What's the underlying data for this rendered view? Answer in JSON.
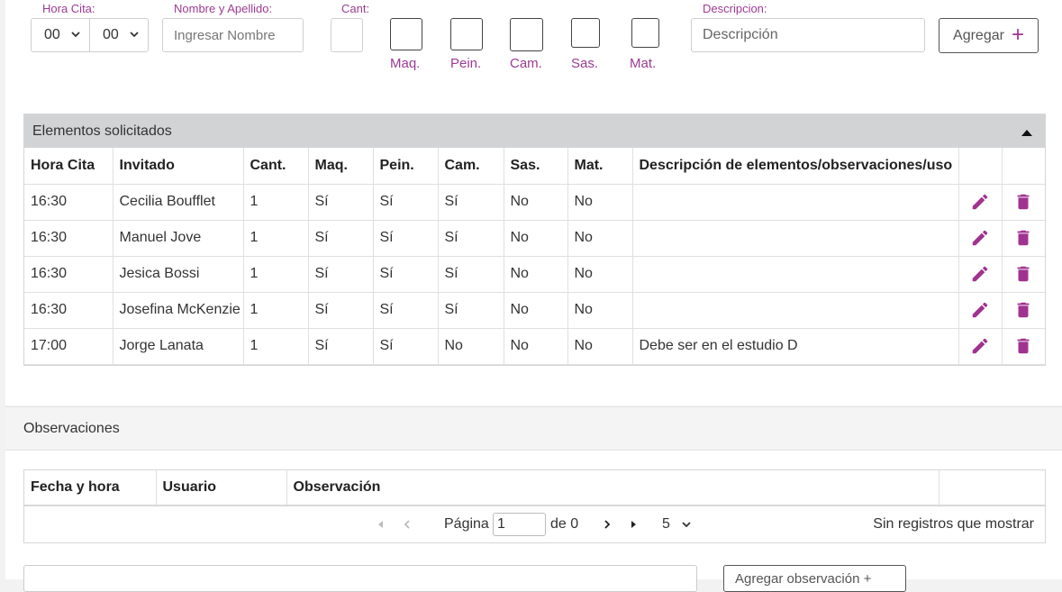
{
  "form": {
    "hora_label": "Hora Cita:",
    "hour_value": "00",
    "minute_value": "00",
    "nombre_label": "Nombre y Apellido:",
    "nombre_placeholder": "Ingresar Nombre",
    "cant_label": "Cant:",
    "checks": [
      "Maq.",
      "Pein.",
      "Cam.",
      "Sas.",
      "Mat."
    ],
    "desc_label": "Descripcion:",
    "desc_placeholder": "Descripción",
    "add_button": "Agregar",
    "add_icon": "+"
  },
  "elementos": {
    "title": "Elementos solicitados",
    "columns": [
      "Hora Cita",
      "Invitado",
      "Cant.",
      "Maq.",
      "Pein.",
      "Cam.",
      "Sas.",
      "Mat.",
      "Descripción de elementos/observaciones/uso",
      "",
      ""
    ],
    "rows": [
      [
        "16:30",
        "Cecilia Boufflet",
        "1",
        "Sí",
        "Sí",
        "Sí",
        "No",
        "No",
        ""
      ],
      [
        "16:30",
        "Manuel Jove",
        "1",
        "Sí",
        "Sí",
        "Sí",
        "No",
        "No",
        ""
      ],
      [
        "16:30",
        "Jesica Bossi",
        "1",
        "Sí",
        "Sí",
        "Sí",
        "No",
        "No",
        ""
      ],
      [
        "16:30",
        "Josefina McKenzie",
        "1",
        "Sí",
        "Sí",
        "Sí",
        "No",
        "No",
        ""
      ],
      [
        "17:00",
        "Jorge Lanata",
        "1",
        "Sí",
        "Sí",
        "No",
        "No",
        "No",
        "Debe ser en el estudio D"
      ]
    ]
  },
  "observaciones": {
    "title": "Observaciones",
    "columns": [
      "Fecha y hora",
      "Usuario",
      "Observación",
      ""
    ],
    "pager": {
      "page_label": "Página",
      "page_value": "1",
      "of_label": "de 0",
      "page_size": "5",
      "empty_text": "Sin registros que mostrar"
    },
    "bottom_button": "Agregar observación +"
  },
  "colors": {
    "accent": "#9b3b93",
    "icon": "#a0338f"
  }
}
